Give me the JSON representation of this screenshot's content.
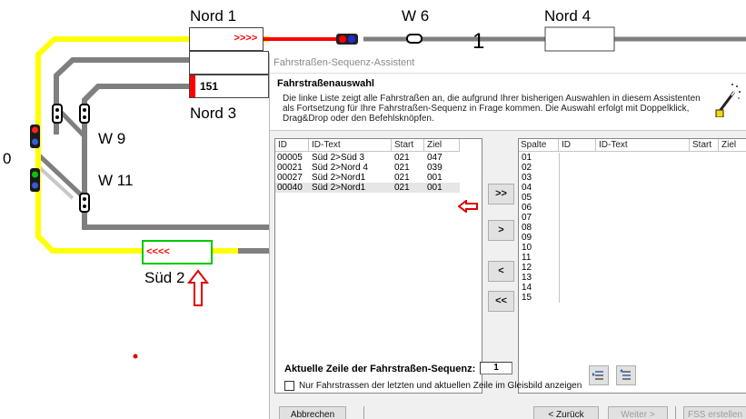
{
  "track": {
    "labels": {
      "nord1": "Nord 1",
      "w6": "W 6",
      "nord4": "Nord 4",
      "nord3": "Nord 3",
      "w9": "W 9",
      "w11": "W 11",
      "sued2": "Süd 2",
      "left_zero": "0",
      "track_one": "1"
    },
    "nord1_block_text": ">>>>",
    "nord3_block_text": "151",
    "sued2_block_text": "<<<<",
    "colors": {
      "track_yellow": "#ffff00",
      "track_gray": "#7f7f7f",
      "route_red": "#ff0000",
      "block_green": "#00c800"
    }
  },
  "dialog": {
    "window_title": "Fahrstraßen-Sequenz-Assistent",
    "header_title": "Fahrstraßenauswahl",
    "header_description": "Die linke Liste zeigt alle Fahrstraßen an, die aufgrund Ihrer bisherigen Auswahlen in diesem Assistenten als Fortsetzung für Ihre Fahrstraßen-Sequenz in Frage kommen. Die Auswahl erfolgt mit Doppelklick, Drag&Drop oder den Befehlsknöpfen.",
    "left_list": {
      "columns": [
        "ID",
        "ID-Text",
        "Start",
        "Ziel"
      ],
      "rows": [
        {
          "id": "00005",
          "text": "Süd 2>Süd 3",
          "start": "021",
          "ziel": "047"
        },
        {
          "id": "00021",
          "text": "Süd 2>Nord 4",
          "start": "021",
          "ziel": "039"
        },
        {
          "id": "00027",
          "text": "Süd 2>Nord1",
          "start": "021",
          "ziel": "001"
        },
        {
          "id": "00040",
          "text": "Süd 2>Nord1",
          "start": "021",
          "ziel": "001"
        }
      ],
      "selected_row": 3
    },
    "transfer_buttons": {
      "add_all": ">>",
      "add_one": ">",
      "remove_one": "<",
      "remove_all": "<<"
    },
    "right_list": {
      "columns": [
        "Spalte",
        "ID",
        "ID-Text",
        "Start",
        "Ziel"
      ],
      "rows": [
        "01",
        "02",
        "03",
        "04",
        "05",
        "06",
        "07",
        "08",
        "09",
        "10",
        "11",
        "12",
        "13",
        "14",
        "15"
      ]
    },
    "current_row_label": "Aktuelle Zeile der Fahrstraßen-Sequenz:",
    "current_row_value": "1",
    "checkbox_label": "Nur Fahrstrassen der letzten und aktuellen Zeile im Gleisbild anzeigen",
    "checkbox_checked": false,
    "buttons": {
      "cancel": "Abbrechen",
      "back": "< Zurück",
      "next": "Weiter >",
      "create": "FSS erstellen"
    }
  }
}
